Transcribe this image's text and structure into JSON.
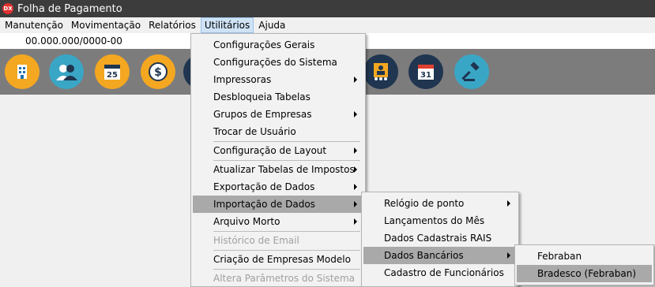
{
  "window": {
    "title": "Folha de Pagamento",
    "icon_label": "DX"
  },
  "menubar": [
    "Manutenção",
    "Movimentação",
    "Relatórios",
    "Utilitários",
    "Ajuda"
  ],
  "company_code": "00.000.000/0000-00",
  "toolbar": {
    "calendar_day_1": "25",
    "calendar_day_2": "31",
    "dollar_symbol": "$",
    "icons": [
      "building-icon",
      "users-icon",
      "calendar-icon",
      "dollar-icon",
      "partial-icon",
      "employees-board-icon",
      "calendar-31-icon",
      "gavel-icon"
    ]
  },
  "utilitarios_menu": {
    "items": [
      {
        "label": "Configurações Gerais"
      },
      {
        "label": "Configurações do Sistema"
      },
      {
        "label": "Impressoras",
        "submenu": true
      },
      {
        "label": "Desbloqueia Tabelas"
      },
      {
        "label": "Grupos de Empresas",
        "submenu": true
      },
      {
        "label": "Trocar de Usuário"
      },
      {
        "label": "Configuração de Layout",
        "submenu": true
      },
      {
        "label": "Atualizar Tabelas de Impostos",
        "submenu": true
      },
      {
        "label": "Exportação de Dados",
        "submenu": true
      },
      {
        "label": "Importação de Dados",
        "submenu": true,
        "highlighted": true
      },
      {
        "label": "Arquivo Morto",
        "submenu": true
      },
      {
        "label": "Histórico de Email",
        "disabled": true
      },
      {
        "label": "Criação de Empresas Modelo"
      },
      {
        "label": "Altera Parâmetros do Sistema",
        "disabled": true
      }
    ]
  },
  "importacao_menu": {
    "items": [
      {
        "label": "Relógio de ponto",
        "submenu": true
      },
      {
        "label": "Lançamentos do Mês"
      },
      {
        "label": "Dados Cadastrais RAIS"
      },
      {
        "label": "Dados Bancários",
        "submenu": true,
        "highlighted": true
      },
      {
        "label": "Cadastro de Funcionários"
      }
    ]
  },
  "dados_bancarios_menu": {
    "items": [
      {
        "label": "Febraban"
      },
      {
        "label": "Bradesco (Febraban)",
        "highlighted": true
      }
    ]
  },
  "colors": {
    "titlebar": "#3c3c3c",
    "toolbar": "#7c7c7c",
    "menu_highlight": "#a9a9a9",
    "orange_icon": "#f4a720",
    "teal_icon": "#3aa6c6",
    "navy_icon": "#1f3550"
  }
}
